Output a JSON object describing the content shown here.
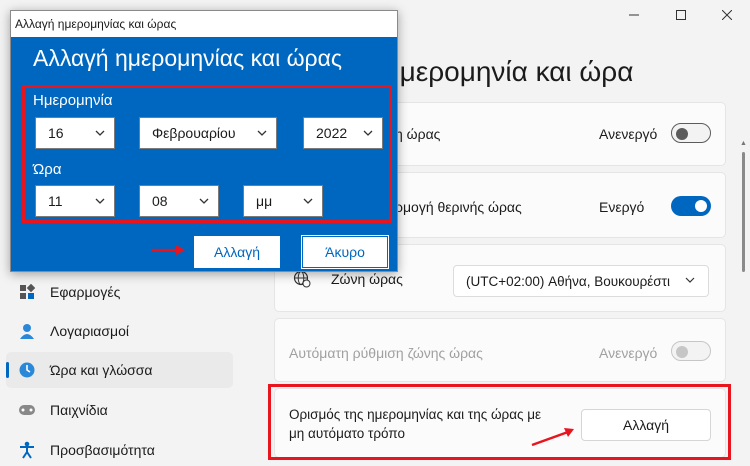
{
  "settings": {
    "page_title": "ημερομηνία και ώρα",
    "cards": {
      "auto_time_label": "η ώρας",
      "auto_time_state": "Ανενεργό",
      "dst_label": "ρμογή θερινής ώρας",
      "dst_state": "Ενεργό",
      "timezone_label": "Ζώνη ώρας",
      "timezone_value": "(UTC+02:00) Αθήνα, Βουκουρέστι",
      "auto_tz_label": "Αυτόματη ρύθμιση ζώνης ώρας",
      "auto_tz_state": "Ανενεργό",
      "manual_label_1": "Ορισμός της ημερομηνίας και της ώρας με",
      "manual_label_2": "μη αυτόματο τρόπο",
      "manual_button": "Αλλαγή"
    },
    "nav": [
      {
        "label": "Εφαρμογές",
        "icon": "apps-icon"
      },
      {
        "label": "Λογαριασμοί",
        "icon": "person-icon"
      },
      {
        "label": "Ώρα και γλώσσα",
        "icon": "time-language-icon",
        "active": true
      },
      {
        "label": "Παιχνίδια",
        "icon": "gamepad-icon"
      },
      {
        "label": "Προσβασιμότητα",
        "icon": "accessibility-icon"
      }
    ]
  },
  "dialog": {
    "window_title": "Αλλαγή ημερομηνίας και ώρας",
    "heading": "Αλλαγή ημερομηνίας και ώρας",
    "date_label": "Ημερομηνία",
    "day": "16",
    "month": "Φεβρουαρίου",
    "year": "2022",
    "time_label": "Ώρα",
    "hour": "11",
    "minute": "08",
    "ampm": "μμ",
    "ok_button": "Αλλαγή",
    "cancel_button": "Άκυρο"
  },
  "colors": {
    "accent": "#0067c0",
    "highlight": "#e8141e"
  }
}
